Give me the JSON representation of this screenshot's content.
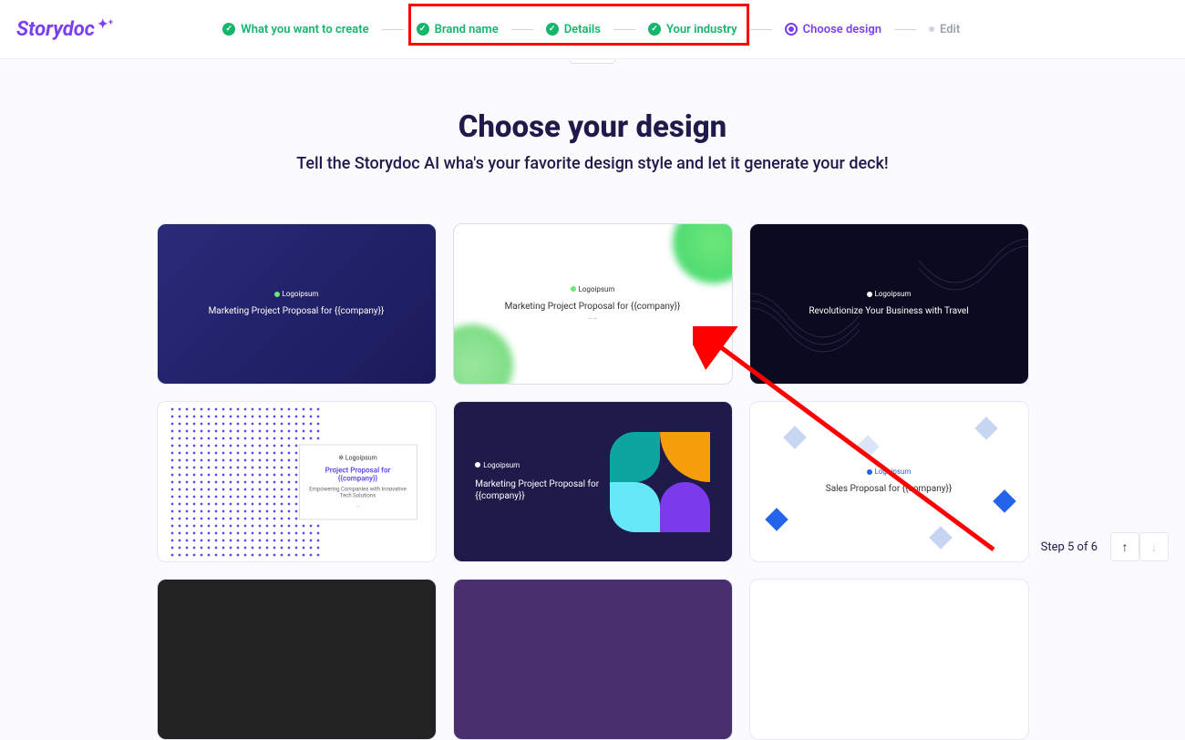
{
  "logo_text": "Storydoc",
  "stepper": {
    "items": [
      {
        "label": "What you want to create",
        "state": "done"
      },
      {
        "label": "Brand name",
        "state": "done"
      },
      {
        "label": "Details",
        "state": "done"
      },
      {
        "label": "Your industry",
        "state": "done"
      },
      {
        "label": "Choose design",
        "state": "current"
      },
      {
        "label": "Edit",
        "state": "pending"
      }
    ]
  },
  "main": {
    "title": "Choose your design",
    "subtitle": "Tell the Storydoc AI wha's your favorite design style and let it generate your deck!"
  },
  "cards": {
    "logo_label": "Logoipsum",
    "c1_title": "Marketing Project Proposal for {{company}}",
    "c2_title": "Marketing Project Proposal for {{company}}",
    "c3_title": "Revolutionize Your Business with Travel",
    "c4_title": "Project Proposal for {{company}}",
    "c4_sub": "Empowering Companies with Innovative Tech Solutions",
    "c5_title": "Marketing Project Proposal for {{company}}",
    "c6_title": "Sales Proposal for {{company}}"
  },
  "footer": {
    "step_label": "Step 5 of 6"
  }
}
